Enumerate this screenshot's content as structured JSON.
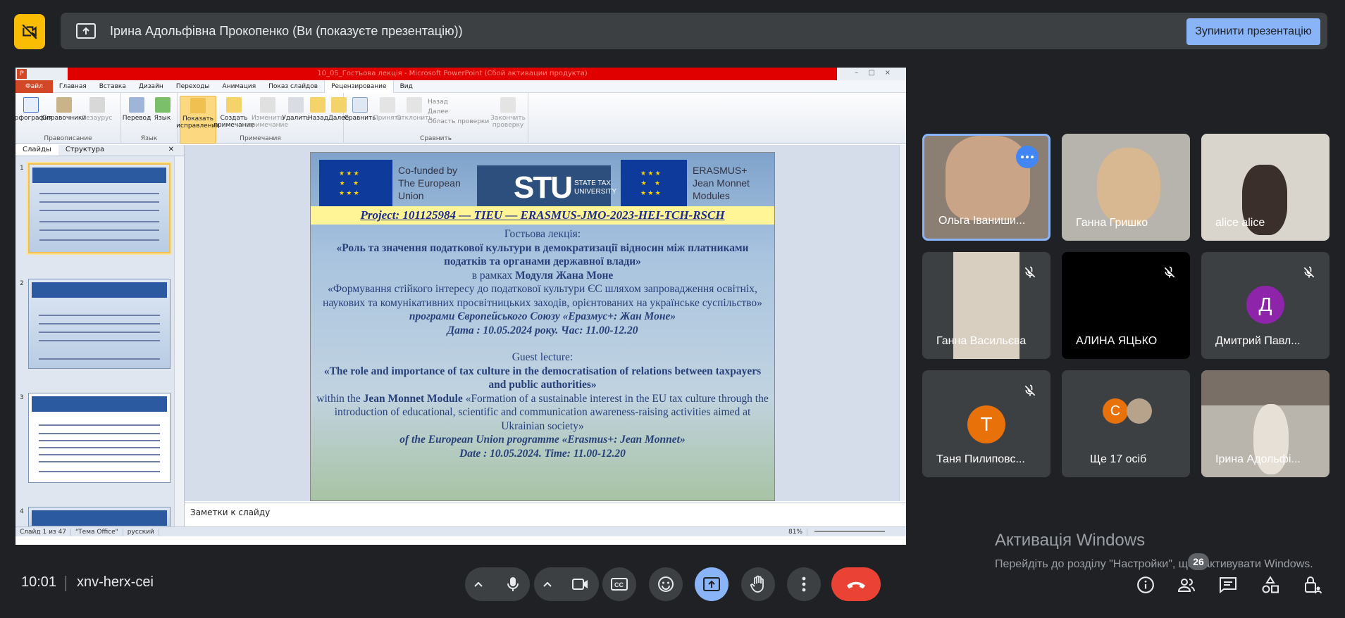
{
  "top_bar": {
    "presenter_text": "Ірина Адольфівна Прокопенко (Ви (показуєте презентацію))",
    "stop_button": "Зупинити презентацію"
  },
  "powerpoint": {
    "window_title": "10_05_Гостьова лекція - Microsoft PowerPoint (Сбой активации продукта)",
    "tabs": [
      "Файл",
      "Главная",
      "Вставка",
      "Дизайн",
      "Переходы",
      "Анимация",
      "Показ слайдов",
      "Рецензирование",
      "Вид"
    ],
    "active_tab": "Рецензирование",
    "ribbon": {
      "spelling": "Орфография",
      "references": "Справочники",
      "thesaurus": "Тезаурус",
      "group_proofing": "Правописание",
      "translate": "Перевод",
      "language": "Язык",
      "group_language": "Язык",
      "show_markup": "Показать исправления",
      "new_comment": "Создать примечание",
      "edit_comment": "Изменить примечание",
      "delete": "Удалить",
      "back": "Назад",
      "next": "Далее",
      "group_comments": "Примечания",
      "compare": "Сравнить",
      "accept": "Принять",
      "reject": "Отклонить",
      "prev_small": "Назад",
      "next_small": "Далее",
      "review_pane": "Область проверки",
      "end_review": "Закончить проверку",
      "group_compare": "Сравнить"
    },
    "left_tabs": [
      "Слайды",
      "Структура"
    ],
    "thumbnail_numbers": [
      "1",
      "2",
      "3",
      "4"
    ],
    "notes_placeholder": "Заметки к слайду",
    "status": {
      "slide": "Слайд 1 из 47",
      "theme": "\"Тема Office\"",
      "lang": "русский",
      "zoom": "81%"
    },
    "slide": {
      "cofunded": "Co-funded by The European Union",
      "stu_big": "STU",
      "stu_small": "STATE TAX UNIVERSITY",
      "erasmus": "ERASMUS+ Jean Monnet Modules",
      "project": "Project: 101125984 — TIEU — ERASMUS-JMO-2023-HEI-TCH-RSCH",
      "ua_guest": "Гостьова лекція:",
      "ua_title": "«Роль та значення податкової культури в демократизації відносин між платниками податків та органами державної влади»",
      "ua_within_prefix": "в рамках ",
      "ua_module": "Модуля Жана Моне",
      "ua_module_text": "«Формування стійкого інтересу до податкової культури ЄС шляхом запровадження освітніх, наукових та комунікативних просвітницьких заходів, орієнтованих на українське суспільство»",
      "ua_program": "програми Європейського Союзу «Еразмус+: Жан Моне»",
      "ua_date": "Дата : 10.05.2024 року. Час: 11.00-12.20",
      "en_guest": "Guest lecture:",
      "en_title": "«The role and importance of tax culture in the democratisation of relations between taxpayers and public authorities»",
      "en_within_prefix": "within the ",
      "en_module": "Jean Monnet Module",
      "en_module_text": " «Formation of a sustainable interest in the EU tax culture through the introduction of educational, scientific and communication awareness-raising activities aimed at Ukrainian society»",
      "en_program": "of the European Union programme «Erasmus+: Jean Monnet»",
      "en_date": "Date : 10.05.2024. Time: 11.00-12.20"
    }
  },
  "participants": [
    {
      "name": "Ольга Іваниши...",
      "muted": false,
      "speaking": true
    },
    {
      "name": "Ганна Гришко",
      "muted": false
    },
    {
      "name": "alice alice",
      "muted": false
    },
    {
      "name": "Ганна Васильєва",
      "muted": true
    },
    {
      "name": "АЛИНА ЯЦЬКО",
      "muted": true
    },
    {
      "name": "Дмитрий Павл...",
      "muted": true,
      "initial": "Д"
    },
    {
      "name": "Таня Пилиповс...",
      "muted": true,
      "initial": "Т"
    },
    {
      "name": "Ще 17 осіб",
      "initial": "С"
    },
    {
      "name": "Ірина Адольфі...",
      "muted": false
    }
  ],
  "bottom_bar": {
    "time": "10:01",
    "meeting_code": "xnv-herx-cei",
    "participant_count": "26"
  },
  "windows_activation": {
    "title": "Активація Windows",
    "text": "Перейдіть до розділу \"Настройки\", щоб активувати Windows."
  },
  "colors": {
    "background": "#202124",
    "accent_blue": "#8ab4f8",
    "end_call_red": "#ea4335",
    "camera_off_yellow": "#fbbc04"
  }
}
